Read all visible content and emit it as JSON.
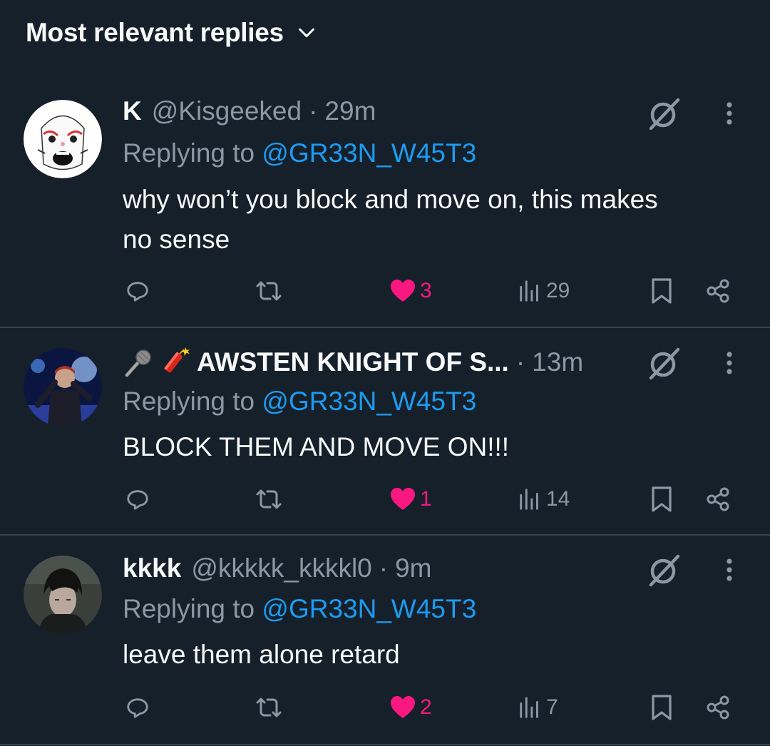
{
  "header": {
    "title": "Most relevant replies",
    "chevron_icon": "chevron-down-icon"
  },
  "colors": {
    "background": "#15202b",
    "text": "#f7f9f9",
    "muted": "#8b98a5",
    "mention": "#1d9bf0",
    "like": "#f91880",
    "divider": "#38444d"
  },
  "replies": [
    {
      "name": "K",
      "handle": "@Kisgeeked",
      "separator": "·",
      "time": "29m",
      "replying_prefix": "Replying to ",
      "replying_to": "@GR33N_W45T3",
      "text_lines": [
        "why won’t you block and move on, this makes",
        "no sense"
      ],
      "likes": "3",
      "views": "29",
      "liked": true,
      "avatar": "cartoon-face-avatar"
    },
    {
      "name_emojis": [
        "microphone-emoji",
        "firecracker-emoji"
      ],
      "name": "AWSTEN KNIGHT OF S...",
      "separator": "·",
      "time": "13m",
      "replying_prefix": "Replying to ",
      "replying_to": "@GR33N_W45T3",
      "text_lines": [
        "BLOCK THEM AND MOVE ON!!!"
      ],
      "likes": "1",
      "views": "14",
      "liked": true,
      "avatar": "concert-singer-avatar"
    },
    {
      "name": "kkkk",
      "handle": "@kkkkk_kkkkl0",
      "separator": "·",
      "time": "9m",
      "replying_prefix": "Replying to ",
      "replying_to": "@GR33N_W45T3",
      "text_lines": [
        "leave them alone retard"
      ],
      "likes": "2",
      "views": "7",
      "liked": true,
      "avatar": "dark-haired-person-avatar"
    }
  ],
  "icons": {
    "reply": "reply-icon",
    "repost": "repost-icon",
    "like": "heart-icon",
    "views": "views-icon",
    "bookmark": "bookmark-icon",
    "share": "share-icon",
    "grok": "grok-icon",
    "more": "more-vertical-icon"
  }
}
